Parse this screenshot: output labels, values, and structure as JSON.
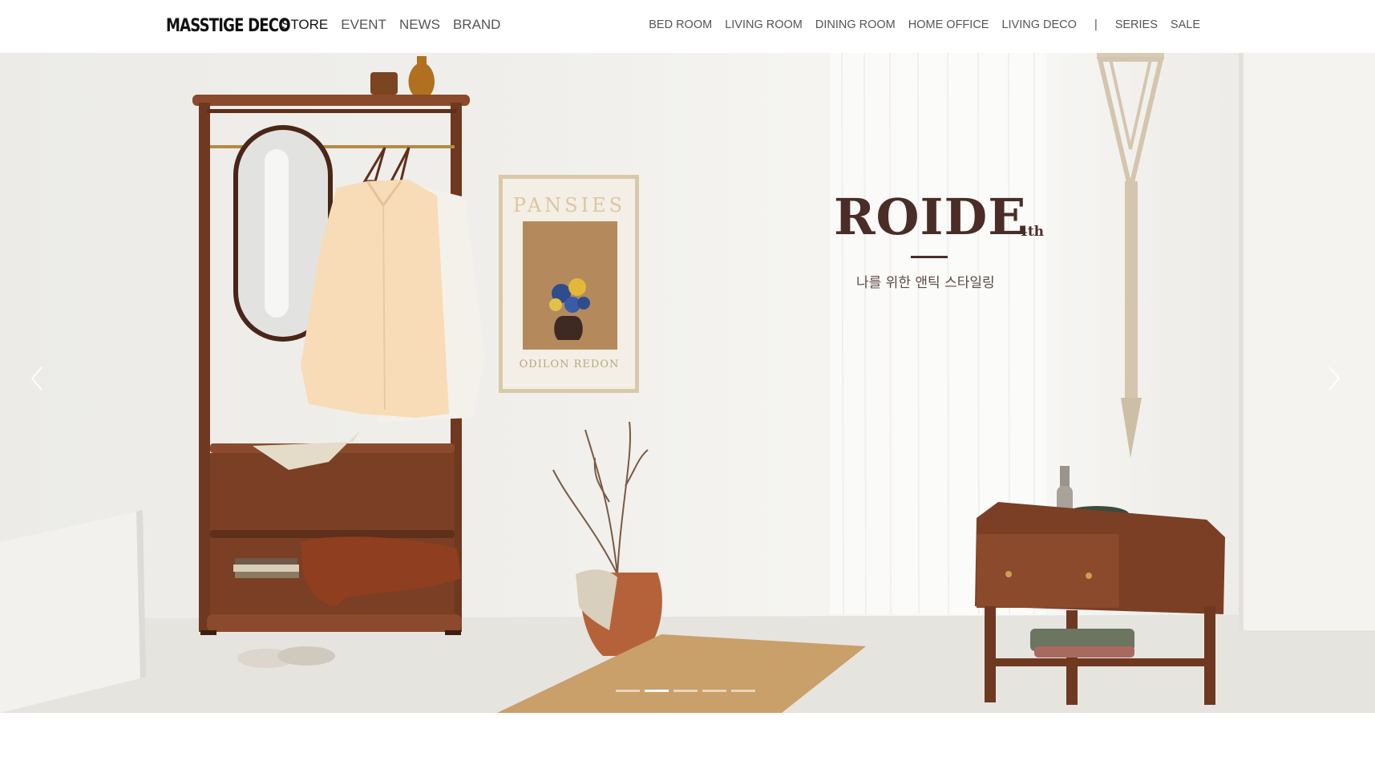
{
  "header": {
    "logo": "MASSTIGE DECO",
    "main_nav": [
      {
        "label": "STORE",
        "active": true
      },
      {
        "label": "EVENT",
        "active": false
      },
      {
        "label": "NEWS",
        "active": false
      },
      {
        "label": "BRAND",
        "active": false
      }
    ],
    "category_nav": [
      "BED ROOM",
      "LIVING ROOM",
      "DINING ROOM",
      "HOME OFFICE",
      "LIVING DECO"
    ],
    "separator": "|",
    "extra_nav": [
      "SERIES",
      "SALE"
    ]
  },
  "hero": {
    "title": "ROIDE",
    "title_suffix": "4th",
    "subtitle": "나를 위한 앤틱 스타일링",
    "poster_title": "PANSIES",
    "poster_caption": "ODILON REDON",
    "prev_icon": "chevron-left-icon",
    "next_icon": "chevron-right-icon",
    "slide_count": 5,
    "active_slide": 2
  },
  "colors": {
    "title_brown": "#4a2d27",
    "wood": "#7a3f24",
    "background": "#ffffff"
  }
}
